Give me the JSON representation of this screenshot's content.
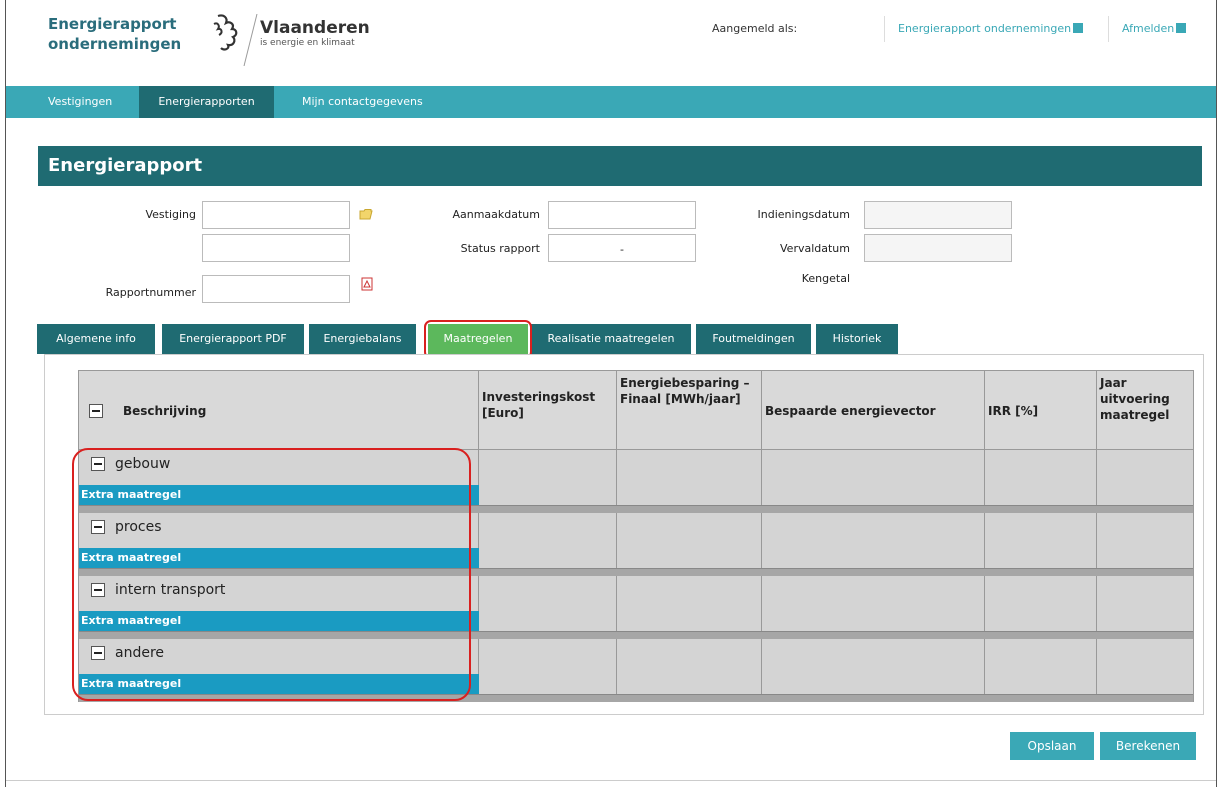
{
  "header": {
    "app_title_line1": "Energierapport",
    "app_title_line2": "ondernemingen",
    "logo_title": "Vlaanderen",
    "logo_subtitle": "is energie en klimaat",
    "logged_in_label": "Aangemeld als:",
    "link_energierapport": "Energierapport ondernemingen",
    "link_afmelden": "Afmelden"
  },
  "nav": {
    "items": [
      "Vestigingen",
      "Energierapporten",
      "Mijn contactgegevens"
    ],
    "active": "Energierapporten"
  },
  "page": {
    "title": "Energierapport"
  },
  "form": {
    "vestiging_label": "Vestiging",
    "rapportnummer_label": "Rapportnummer",
    "aanmaakdatum_label": "Aanmaakdatum",
    "status_label": "Status rapport",
    "status_value": "-",
    "indieningsdatum_label": "Indieningsdatum",
    "vervaldatum_label": "Vervaldatum",
    "kengetal_label": "Kengetal"
  },
  "tabs": [
    "Algemene info",
    "Energierapport PDF",
    "Energiebalans",
    "Maatregelen",
    "Realisatie maatregelen",
    "Foutmeldingen",
    "Historiek"
  ],
  "active_tab": "Maatregelen",
  "table": {
    "headers": {
      "beschrijving": "Beschrijving",
      "investeringskost": "Investeringskost [Euro]",
      "energiebesparing": "Energiebesparing – Finaal [MWh/jaar]",
      "vector": "Bespaarde energievector",
      "irr": "IRR [%]",
      "jaar": "Jaar uitvoering maatregel"
    },
    "groups": [
      {
        "name": "gebouw",
        "extra": "Extra maatregel"
      },
      {
        "name": "proces",
        "extra": "Extra maatregel"
      },
      {
        "name": "intern transport",
        "extra": "Extra maatregel"
      },
      {
        "name": "andere",
        "extra": "Extra maatregel"
      }
    ]
  },
  "buttons": {
    "save": "Opslaan",
    "calculate": "Berekenen"
  },
  "colors": {
    "teal_dark": "#1f6b72",
    "teal_light": "#3aa8b6",
    "tab_active": "#5cb85c",
    "extra_bar": "#1a9bc2",
    "highlight": "#d9201f"
  }
}
